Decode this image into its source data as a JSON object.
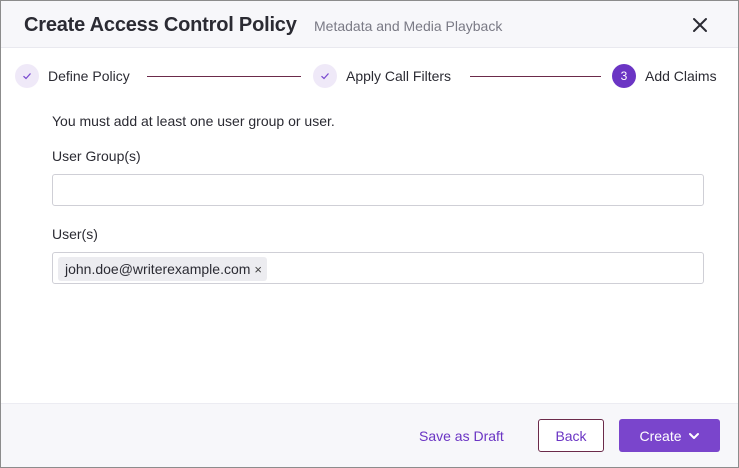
{
  "dialog": {
    "title": "Create Access Control Policy",
    "subtitle": "Metadata and Media Playback",
    "close_icon": "close-icon"
  },
  "steps": [
    {
      "label": "Define Policy",
      "state": "done",
      "marker": "✓"
    },
    {
      "label": "Apply Call Filters",
      "state": "done",
      "marker": "✓"
    },
    {
      "label": "Add Claims",
      "state": "active",
      "marker": "3"
    }
  ],
  "form": {
    "notice": "You must add at least one user group or user.",
    "user_groups": {
      "label": "User Group(s)",
      "value": "",
      "placeholder": ""
    },
    "users": {
      "label": "User(s)",
      "chips": [
        {
          "text": "john.doe@writerexample.com",
          "remove": "×"
        }
      ]
    }
  },
  "footer": {
    "save_draft_label": "Save as Draft",
    "back_label": "Back",
    "create_label": "Create"
  },
  "colors": {
    "accent": "#6b35c4",
    "step_line": "#6b2a4a",
    "header_bg": "#f7f7fa"
  }
}
